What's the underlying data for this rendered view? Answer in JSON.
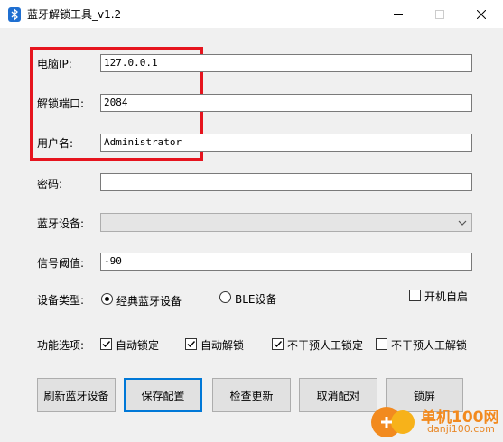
{
  "window": {
    "title": "蓝牙解锁工具_v1.2",
    "icon": "bluetooth-icon"
  },
  "form": {
    "pc_ip_label": "电脑IP:",
    "pc_ip_value": "127.0.0.1",
    "port_label": "解锁端口:",
    "port_value": "2084",
    "username_label": "用户名:",
    "username_value": "Administrator",
    "password_label": "密码:",
    "password_value": "",
    "device_label": "蓝牙设备:",
    "device_value": "",
    "threshold_label": "信号阈值:",
    "threshold_value": "-90"
  },
  "device_type": {
    "label": "设备类型:",
    "options": [
      {
        "label": "经典蓝牙设备",
        "checked": true
      },
      {
        "label": "BLE设备",
        "checked": false
      }
    ],
    "autostart_label": "开机自启",
    "autostart_checked": false
  },
  "features": {
    "label": "功能选项:",
    "options": [
      {
        "label": "自动锁定",
        "checked": true
      },
      {
        "label": "自动解锁",
        "checked": true
      },
      {
        "label": "不干预人工锁定",
        "checked": true
      },
      {
        "label": "不干预人工解锁",
        "checked": false
      }
    ]
  },
  "buttons": {
    "refresh": "刷新蓝牙设备",
    "save": "保存配置",
    "check_update": "检查更新",
    "cancel_pair": "取消配对",
    "lock": "锁屏"
  },
  "watermark": {
    "name": "单机100网",
    "url": "danji100.com"
  },
  "colors": {
    "highlight_box": "#e6141e",
    "default_button_border": "#0078d7",
    "window_bg": "#f0f0f0"
  }
}
